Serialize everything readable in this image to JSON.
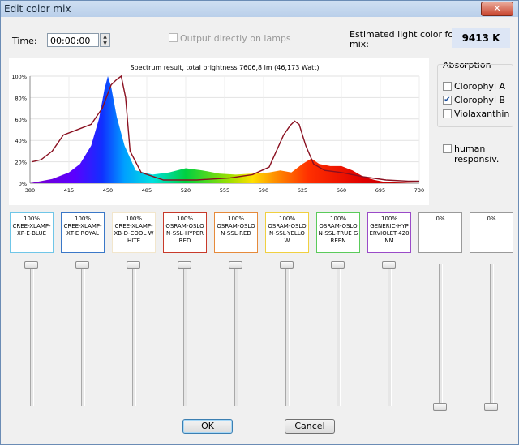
{
  "window": {
    "title": "Edit color mix",
    "close_label": "✕"
  },
  "time": {
    "label": "Time:",
    "value": "00:00:00"
  },
  "output_directly": {
    "label": "Output directly on lamps",
    "checked": false
  },
  "estimate": {
    "label_line1": "Estimated light color for this",
    "label_line2": "mix:",
    "value": "9413 K"
  },
  "absorption": {
    "title": "Absorption",
    "items": [
      {
        "label": "Clorophyl A",
        "checked": false
      },
      {
        "label": "Clorophyl B",
        "checked": true
      },
      {
        "label": "Violaxanthin",
        "checked": false
      }
    ]
  },
  "human_response": {
    "label": "human responsiv.",
    "checked": false
  },
  "chart_data": {
    "type": "area",
    "title": "Spectrum result, total brightness 7606,8 lm (46,173 Watt)",
    "xlim": [
      380,
      730
    ],
    "ylim": [
      0,
      100
    ],
    "x_ticks": [
      "380",
      "415",
      "450",
      "485",
      "520",
      "555",
      "590",
      "625",
      "660",
      "695",
      "730"
    ],
    "y_ticks": [
      "0%",
      "20%",
      "40%",
      "60%",
      "80%",
      "100%"
    ],
    "grid": true,
    "spectrum_x": [
      380,
      400,
      415,
      425,
      435,
      442,
      447,
      450,
      453,
      458,
      465,
      475,
      490,
      505,
      520,
      535,
      550,
      565,
      580,
      595,
      605,
      615,
      625,
      633,
      640,
      650,
      660,
      670,
      680,
      690,
      700,
      715,
      730
    ],
    "spectrum_y": [
      0,
      4,
      10,
      18,
      35,
      60,
      88,
      100,
      90,
      62,
      35,
      12,
      8,
      10,
      14,
      12,
      9,
      8,
      9,
      10,
      12,
      10,
      18,
      23,
      18,
      16,
      16,
      12,
      6,
      3,
      1,
      0.5,
      0
    ],
    "absorption_series": {
      "name": "Clorophyl B",
      "x": [
        382,
        390,
        400,
        410,
        420,
        435,
        445,
        453,
        458,
        462,
        466,
        470,
        480,
        500,
        530,
        560,
        580,
        595,
        608,
        614,
        618,
        622,
        628,
        635,
        645,
        660,
        680,
        700,
        720,
        730
      ],
      "y": [
        20,
        22,
        30,
        45,
        49,
        55,
        70,
        92,
        97,
        100,
        80,
        30,
        10,
        3,
        3,
        5,
        8,
        15,
        45,
        54,
        58,
        55,
        35,
        18,
        12,
        10,
        6,
        3,
        2,
        2
      ]
    }
  },
  "lamps": [
    {
      "pct": "100%",
      "name": "CREE-XLAMP-XP-E-BLUE",
      "border": "#6fc6e8",
      "slider_value": 100
    },
    {
      "pct": "100%",
      "name": "CREE-XLAMP-XT-E ROYAL",
      "border": "#3a78c8",
      "slider_value": 100
    },
    {
      "pct": "100%",
      "name": "CREE-XLAMP-XB-D-COOL WHITE",
      "border": "#f2e6cc",
      "slider_value": 100
    },
    {
      "pct": "100%",
      "name": "OSRAM-OSLON-SSL-HYPERRED",
      "border": "#c83a2a",
      "slider_value": 100
    },
    {
      "pct": "100%",
      "name": "OSRAM-OSLON-SSL-RED",
      "border": "#e68a3a",
      "slider_value": 100
    },
    {
      "pct": "100%",
      "name": "OSRAM-OSLON-SSL-YELLOW",
      "border": "#f0d040",
      "slider_value": 100
    },
    {
      "pct": "100%",
      "name": "OSRAM-OSLON-SSL-TRUE GREEN",
      "border": "#5acb5a",
      "slider_value": 100
    },
    {
      "pct": "100%",
      "name": "GENERIC-HYPERVIOLET-420NM",
      "border": "#9a4ac8",
      "slider_value": 100
    },
    {
      "pct": "0%",
      "name": "",
      "border": "#9a9a9a",
      "slider_value": 0
    },
    {
      "pct": "0%",
      "name": "",
      "border": "#9a9a9a",
      "slider_value": 0
    }
  ],
  "buttons": {
    "ok": "OK",
    "cancel": "Cancel"
  }
}
